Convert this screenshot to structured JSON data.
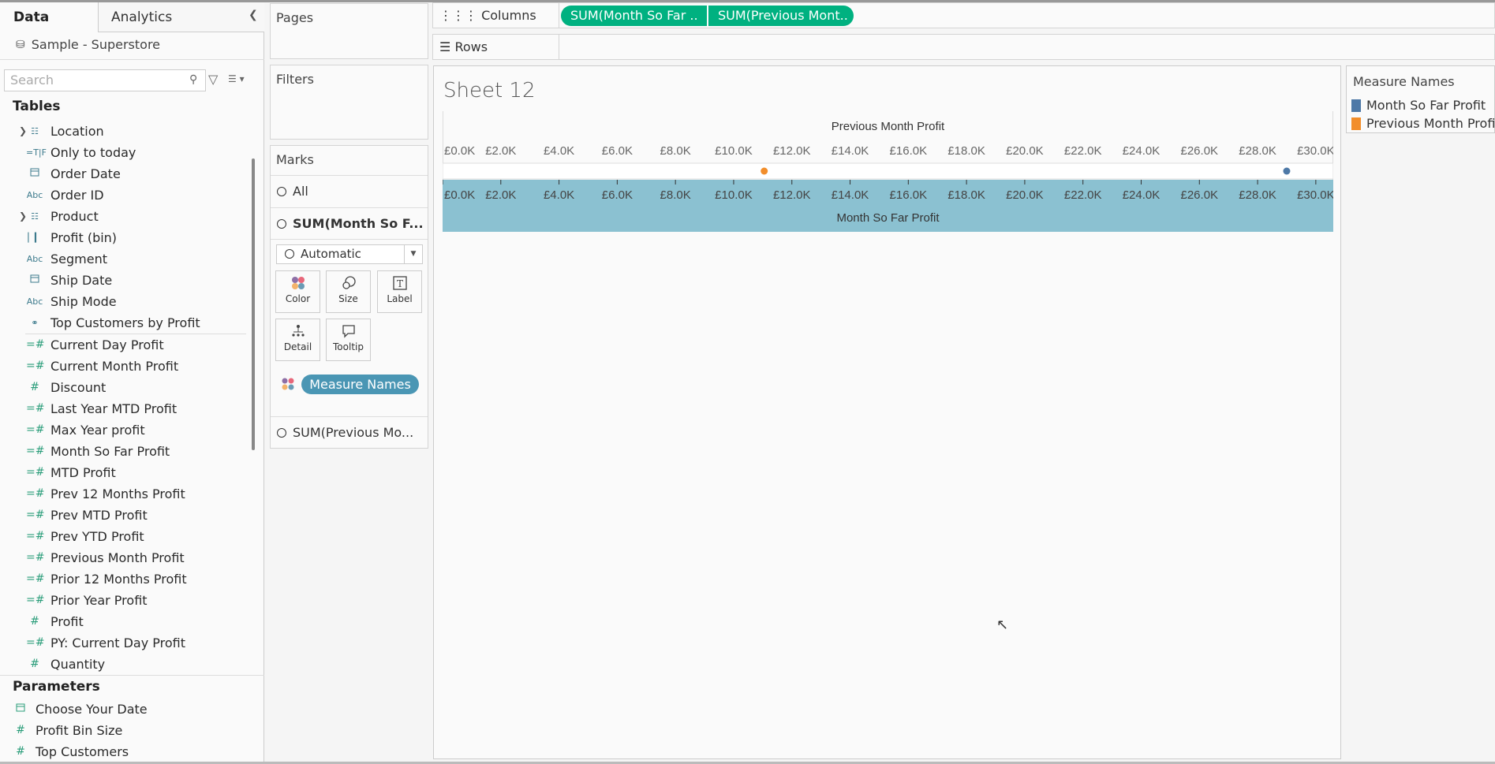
{
  "left_pane": {
    "tabs": [
      "Data",
      "Analytics"
    ],
    "datasource": "Sample - Superstore",
    "search_placeholder": "Search",
    "tables_heading": "Tables",
    "dimensions": [
      {
        "label": "Location",
        "icon": "hierarchy-icon",
        "expandable": true
      },
      {
        "label": "Only to today",
        "icon": "boolean-icon"
      },
      {
        "label": "Order Date",
        "icon": "calendar-icon"
      },
      {
        "label": "Order ID",
        "icon": "abc-icon"
      },
      {
        "label": "Product",
        "icon": "hierarchy-icon",
        "expandable": true
      },
      {
        "label": "Profit (bin)",
        "icon": "bin-icon"
      },
      {
        "label": "Segment",
        "icon": "abc-icon"
      },
      {
        "label": "Ship Date",
        "icon": "calendar-icon"
      },
      {
        "label": "Ship Mode",
        "icon": "abc-icon"
      },
      {
        "label": "Top Customers by Profit",
        "icon": "set-icon"
      }
    ],
    "measures": [
      {
        "label": "Current Day Profit",
        "icon": "calc-measure-icon"
      },
      {
        "label": "Current Month Profit",
        "icon": "calc-measure-icon"
      },
      {
        "label": "Discount",
        "icon": "measure-icon"
      },
      {
        "label": "Last Year MTD Profit",
        "icon": "calc-measure-icon"
      },
      {
        "label": "Max Year profit",
        "icon": "calc-measure-icon"
      },
      {
        "label": "Month So Far Profit",
        "icon": "calc-measure-icon"
      },
      {
        "label": "MTD Profit",
        "icon": "calc-measure-icon"
      },
      {
        "label": "Prev 12 Months Profit",
        "icon": "calc-measure-icon"
      },
      {
        "label": "Prev MTD Profit",
        "icon": "calc-measure-icon"
      },
      {
        "label": "Prev YTD Profit",
        "icon": "calc-measure-icon"
      },
      {
        "label": "Previous Month Profit",
        "icon": "calc-measure-icon"
      },
      {
        "label": "Prior 12 Months Profit",
        "icon": "calc-measure-icon"
      },
      {
        "label": "Prior Year Profit",
        "icon": "calc-measure-icon"
      },
      {
        "label": "Profit",
        "icon": "measure-icon"
      },
      {
        "label": "PY: Current Day Profit",
        "icon": "calc-measure-icon"
      },
      {
        "label": "Quantity",
        "icon": "measure-icon"
      }
    ],
    "parameters_heading": "Parameters",
    "parameters": [
      {
        "label": "Choose Your Date",
        "icon": "calendar-icon"
      },
      {
        "label": "Profit Bin Size",
        "icon": "measure-icon"
      },
      {
        "label": "Top Customers",
        "icon": "measure-icon"
      }
    ]
  },
  "cards": {
    "pages": "Pages",
    "filters": "Filters",
    "marks": {
      "title": "Marks",
      "all": "All",
      "card1": "SUM(Month So F...",
      "mark_type": "Automatic",
      "buttons": [
        "Color",
        "Size",
        "Label",
        "Detail",
        "Tooltip"
      ],
      "color_pill": "Measure Names",
      "card2": "SUM(Previous Mo..."
    }
  },
  "shelves": {
    "columns_label": "Columns",
    "rows_label": "Rows",
    "column_pills": [
      "SUM(Month So Far ..",
      "SUM(Previous Mont.."
    ]
  },
  "view": {
    "sheet_title": "Sheet 12"
  },
  "legend": {
    "title": "Measure Names",
    "items": [
      {
        "label": "Month So Far Profit",
        "color": "#4e79a7"
      },
      {
        "label": "Previous Month Profit",
        "color": "#f28e2b"
      }
    ]
  },
  "chart_data": {
    "type": "scatter",
    "top_axis_title": "Previous Month Profit",
    "bottom_axis_title": "Month So Far Profit",
    "ticks": [
      "£0.0K",
      "£2.0K",
      "£4.0K",
      "£6.0K",
      "£8.0K",
      "£10.0K",
      "£12.0K",
      "£14.0K",
      "£16.0K",
      "£18.0K",
      "£20.0K",
      "£22.0K",
      "£24.0K",
      "£26.0K",
      "£28.0K",
      "£30.0K"
    ],
    "tick_values": [
      0,
      2000,
      4000,
      6000,
      8000,
      10000,
      12000,
      14000,
      16000,
      18000,
      20000,
      22000,
      24000,
      26000,
      28000,
      30000
    ],
    "xlim": [
      0,
      30600
    ],
    "points": [
      {
        "series": "Previous Month Profit",
        "value": 11050,
        "color": "#f28e2b"
      },
      {
        "series": "Month So Far Profit",
        "value": 29000,
        "color": "#4e79a7"
      }
    ],
    "axis_band_color": "#8bc1d1"
  }
}
